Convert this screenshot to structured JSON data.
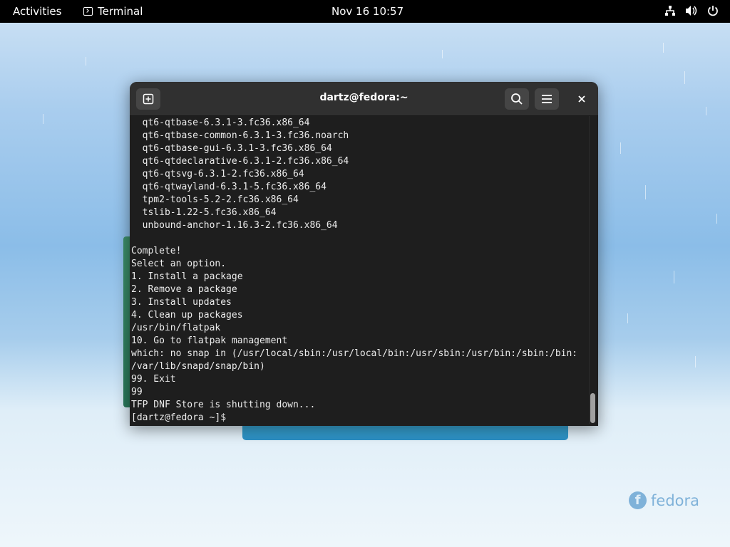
{
  "topbar": {
    "activities": "Activities",
    "app_name": "Terminal",
    "clock": "Nov 16  10:57",
    "tray_icons": [
      "network-icon",
      "volume-icon",
      "power-icon"
    ]
  },
  "window": {
    "title": "dartz@fedora:~",
    "buttons": [
      "new-tab-icon",
      "search-icon",
      "hamburger-menu-icon",
      "close-icon"
    ]
  },
  "terminal": {
    "lines": [
      "  qt6-qtbase-6.3.1-3.fc36.x86_64",
      "  qt6-qtbase-common-6.3.1-3.fc36.noarch",
      "  qt6-qtbase-gui-6.3.1-3.fc36.x86_64",
      "  qt6-qtdeclarative-6.3.1-2.fc36.x86_64",
      "  qt6-qtsvg-6.3.1-2.fc36.x86_64",
      "  qt6-qtwayland-6.3.1-5.fc36.x86_64",
      "  tpm2-tools-5.2-2.fc36.x86_64",
      "  tslib-1.22-5.fc36.x86_64",
      "  unbound-anchor-1.16.3-2.fc36.x86_64",
      "",
      "Complete!",
      "Select an option.",
      "1. Install a package",
      "2. Remove a package",
      "3. Install updates",
      "4. Clean up packages",
      "/usr/bin/flatpak",
      "10. Go to flatpak management",
      "which: no snap in (/usr/local/sbin:/usr/local/bin:/usr/sbin:/usr/bin:/sbin:/bin:",
      "/var/lib/snapd/snap/bin)",
      "99. Exit",
      "99",
      "TFP DNF Store is shutting down...",
      "[dartz@fedora ~]$ "
    ]
  },
  "watermark": {
    "text": "fedora"
  },
  "colors": {
    "terminal_bg": "#1e1e1e",
    "headerbar_bg": "#303030",
    "terminal_fg": "#ececec",
    "topbar_bg": "#000000"
  }
}
